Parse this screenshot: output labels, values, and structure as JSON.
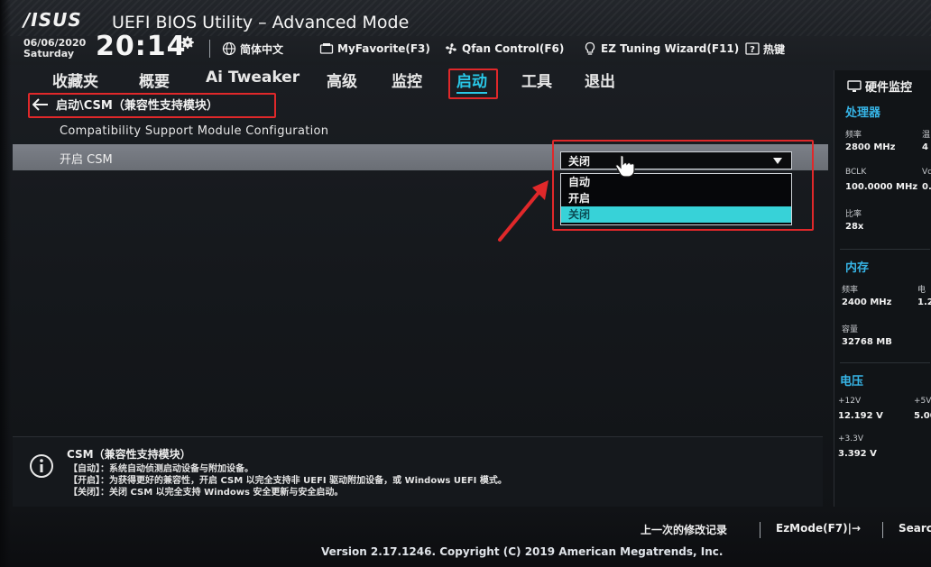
{
  "header": {
    "logo": "/ISUS",
    "title": "UEFI BIOS Utility – Advanced Mode",
    "date": "06/06/2020",
    "day": "Saturday",
    "time": "20:14",
    "tools": [
      {
        "label": "简体中文",
        "icon": "globe-icon"
      },
      {
        "label": "MyFavorite(F3)",
        "icon": "favorite-icon"
      },
      {
        "label": "Qfan Control(F6)",
        "icon": "fan-icon"
      },
      {
        "label": "EZ Tuning Wizard(F11)",
        "icon": "bulb-icon"
      },
      {
        "label": "热键",
        "icon": "help-icon"
      }
    ]
  },
  "tabs": [
    {
      "label": "收藏夹",
      "active": false
    },
    {
      "label": "概要",
      "active": false
    },
    {
      "label": "Ai Tweaker",
      "active": false
    },
    {
      "label": "高级",
      "active": false
    },
    {
      "label": "监控",
      "active": false
    },
    {
      "label": "启动",
      "active": true
    },
    {
      "label": "工具",
      "active": false
    },
    {
      "label": "退出",
      "active": false
    }
  ],
  "main": {
    "breadcrumb": "启动\\CSM（兼容性支持模块）",
    "section_title": "Compatibility Support Module Configuration",
    "setting_label": "开启 CSM",
    "setting_value": "关闭",
    "options": [
      {
        "label": "自动",
        "selected": false
      },
      {
        "label": "开启",
        "selected": false
      },
      {
        "label": "关闭",
        "selected": true
      }
    ]
  },
  "right_panel": {
    "title": "硬件监控",
    "cpu": {
      "heading": "处理器",
      "freq_label": "频率",
      "freq_value": "2800 MHz",
      "temp_label": "温",
      "temp_value": "4",
      "bclk_label": "BCLK",
      "bclk_value": "100.0000 MHz",
      "vcore_label": "Vc",
      "vcore_value": "0.",
      "ratio_label": "比率",
      "ratio_value": "28x"
    },
    "memory": {
      "heading": "内存",
      "freq_label": "频率",
      "freq_value": "2400 MHz",
      "volt_label": "电",
      "volt_value": "1.2",
      "cap_label": "容量",
      "cap_value": "32768 MB"
    },
    "voltage": {
      "heading": "电压",
      "v12_label": "+12V",
      "v12_value": "12.192 V",
      "v5_label": "+5V",
      "v5_value": "5.00",
      "v33_label": "+3.3V",
      "v33_value": "3.392 V"
    }
  },
  "help": {
    "title": "CSM（兼容性支持模块）",
    "lines": [
      "【自动】：系统自动侦测启动设备与附加设备。",
      "【开启】：为获得更好的兼容性，开启 CSM 以完全支持非 UEFI 驱动附加设备，或 Windows UEFI 模式。",
      "【关闭】：关闭 CSM 以完全支持 Windows 安全更新与安全启动。"
    ]
  },
  "footer": {
    "last_modified": "上一次的修改记录",
    "ezmode": "EzMode(F7)|→",
    "search": "Searc",
    "copyright": "Version 2.17.1246. Copyright (C) 2019 American Megatrends, Inc."
  },
  "colors": {
    "accent": "#29c8e8",
    "highlight_row": "#6f737a",
    "selected_option": "#37d2d8",
    "annotation_red": "#e0282a"
  }
}
